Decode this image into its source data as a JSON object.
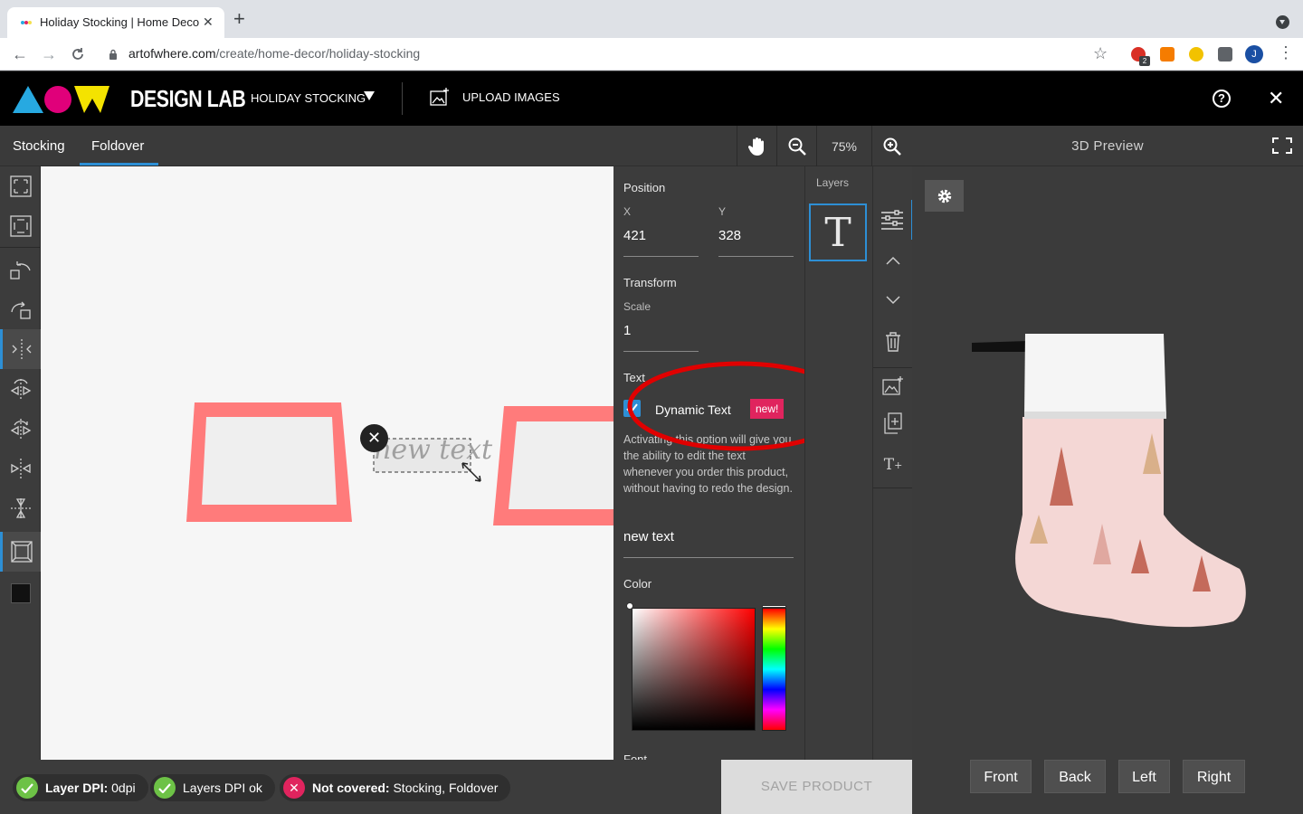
{
  "browser": {
    "tab_title": "Holiday Stocking | Home Decor",
    "url_host": "artofwhere.com",
    "url_path": "/create/home-decor/holiday-stocking",
    "avatar_letter": "J",
    "ext_badge": "2"
  },
  "header": {
    "brand": "DESIGN LAB",
    "product": "HOLIDAY STOCKING",
    "upload_label": "UPLOAD IMAGES"
  },
  "editor": {
    "tabs": [
      "Stocking",
      "Foldover"
    ],
    "active_tab": "Foldover",
    "zoom": "75%"
  },
  "canvas": {
    "text_layer": "new text"
  },
  "properties": {
    "position_label": "Position",
    "x_label": "X",
    "y_label": "Y",
    "x_value": "421",
    "y_value": "328",
    "transform_label": "Transform",
    "scale_label": "Scale",
    "scale_value": "1",
    "text_label": "Text",
    "dynamic_text_label": "Dynamic Text",
    "dynamic_text_checked": true,
    "new_badge": "new!",
    "dynamic_text_help": "Activating this option will give you the ability to edit the text whenever you order this product, without having to redo the design.",
    "text_value": "new text",
    "color_label": "Color",
    "font_label": "Font"
  },
  "layers": {
    "title": "Layers",
    "items": [
      {
        "icon": "text-layer-icon",
        "glyph": "T"
      }
    ]
  },
  "preview": {
    "title": "3D Preview",
    "views": [
      "Front",
      "Back",
      "Left",
      "Right"
    ]
  },
  "status": {
    "layer_dpi_label": "Layer DPI:",
    "layer_dpi_value": "0dpi",
    "layers_dpi_ok": "Layers DPI ok",
    "not_covered_label": "Not covered:",
    "not_covered_value": "Stocking, Foldover"
  },
  "actions": {
    "save_label": "SAVE PRODUCT"
  },
  "colors": {
    "accent_blue": "#2d8fd5",
    "badge_pink": "#e0245e",
    "ok_green": "#6dc246",
    "annotation_red": "#e00000",
    "panel_bg": "#3c3c3c",
    "header_bg": "#000000"
  }
}
